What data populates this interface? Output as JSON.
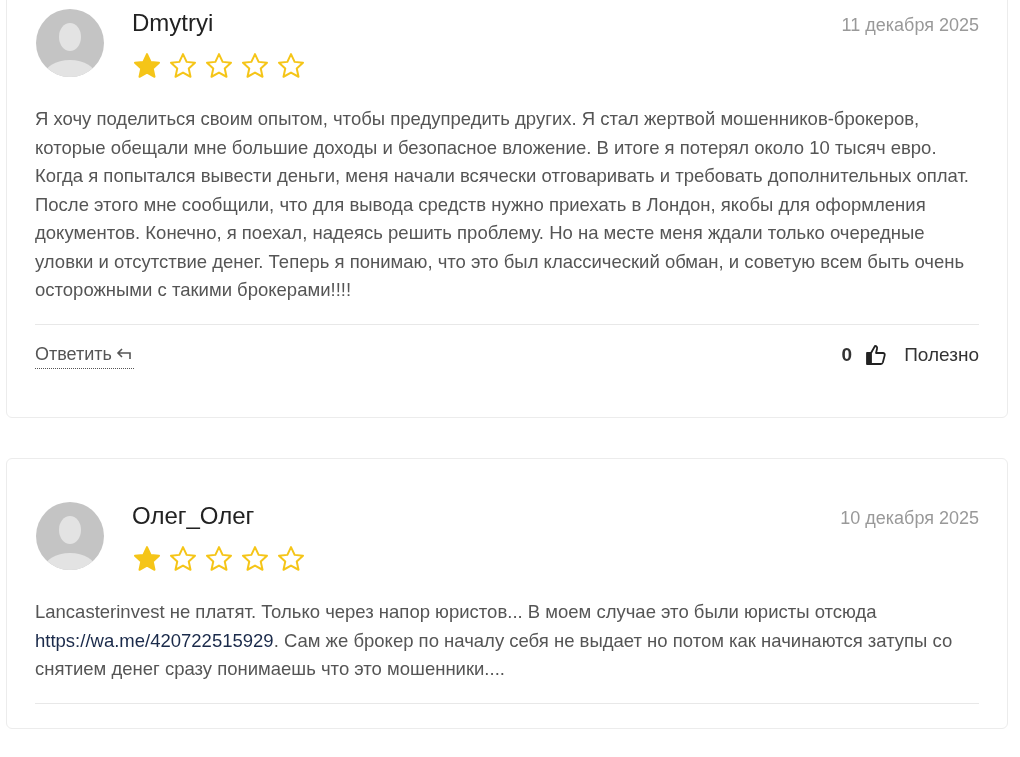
{
  "reviews": [
    {
      "author": "Dmytryi",
      "date": "11 декабря 2025",
      "stars": 1,
      "body": [
        {
          "kind": "text",
          "text": "Я хочу поделиться своим опытом, чтобы предупредить других. Я стал жертвой мошенников-брокеров, которые обещали мне большие доходы и безопасное вложение. В итоге я потерял около 10 тысяч евро. Когда я попытался вывести деньги, меня начали всячески отговаривать и требовать дополнительных оплат. После этого мне сообщили, что для вывода средств нужно приехать в Лондон, якобы для оформления документов. Конечно, я поехал, надеясь решить проблему. Но на месте меня ждали только очередные уловки и отсутствие денег. Теперь я понимаю, что это был классический обман, и советую всем быть очень осторожными с такими брокерами!!!!"
        }
      ],
      "footer": {
        "reply": "Ответить",
        "likes": "0",
        "helpful": "Полезно"
      }
    },
    {
      "author": "Олег_Олег",
      "date": "10 декабря 2025",
      "stars": 1,
      "body": [
        {
          "kind": "text",
          "text": "Lancasterinvest не платят. Только через напор юристов... В моем случае это были юристы отсюда "
        },
        {
          "kind": "link",
          "text": "https://wa.me/420722515929"
        },
        {
          "kind": "text",
          "text": ". Сам же брокер по началу себя не выдает но потом как начинаются затупы со снятием денег сразу понимаешь что это мошенники...."
        }
      ]
    }
  ]
}
